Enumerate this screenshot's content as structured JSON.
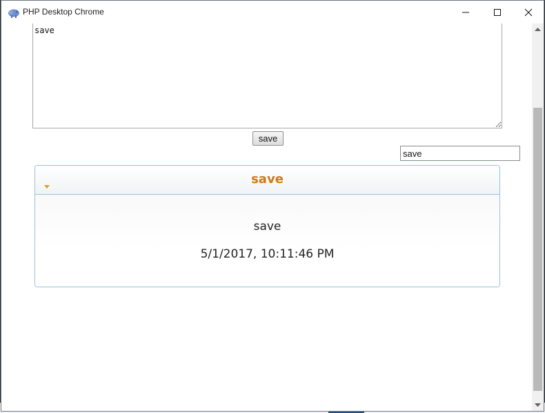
{
  "window": {
    "title": "PHP Desktop Chrome",
    "icon": "elephant-icon",
    "controls": [
      "minimize-icon",
      "maximize-icon",
      "close-icon"
    ]
  },
  "editor": {
    "textarea_value": "save",
    "save_button_label": "save"
  },
  "filter": {
    "value": "save"
  },
  "panel": {
    "title": "save",
    "entry_text": "save",
    "entry_date": "5/1/2017, 10:11:46 PM"
  },
  "colors": {
    "panel_title": "#d07a17",
    "panel_border": "#96c3dc",
    "scroll_thumb": "#b9b9b9"
  }
}
